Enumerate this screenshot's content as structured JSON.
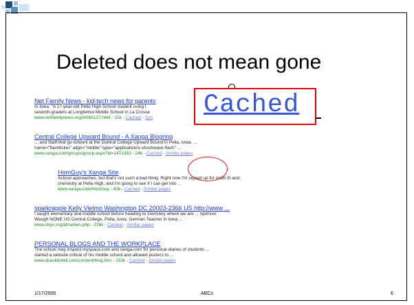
{
  "slide": {
    "title": "Deleted does not mean gone",
    "footer_date": "1/17/2008",
    "footer_center": "ABCs",
    "slide_number": "6",
    "accent_colors": {
      "corner_dark": "#1f4f7a",
      "corner_light": "#9cc3e0",
      "highlight_red": "#e30000"
    }
  },
  "callout": {
    "cached_label": "Cached"
  },
  "results": [
    {
      "title": "Net Family News - kid-tech news for parents",
      "snippet1": "In Iowa: \"A 17-year-old Pella High School student using t",
      "snippet2": "seventh-graders at Longfellow Middle School in La Crosse",
      "url": "www.netfamilynews.org/nl060127.html - 31k - ",
      "cached": "Cached",
      "sep": " - ",
      "similar": "Sim"
    },
    {
      "title": "Central College Upward Bound - A Xanga Blogring",
      "snippet1": "... and Staff that go to/work at the Central College Upward Bound in Pella, Iowa. ...",
      "snippet2": "name=\"flashticker\" align=\"middle\" type=\"application/x-shockwave-flash\" ...",
      "url": "www.xanga.com/groups/group.aspx?id=1471363 - 24k - ",
      "cached": "Cached",
      "sep": " - ",
      "similar": "Similar pages"
    },
    {
      "title": "HomGuy's Xanga Site",
      "snippet1": "School approaches, but that's not such a bad thing. Right now I'm signed up for math III and",
      "snippet2": "chemistry at Pella High, and I'm going to see if I can get into ...",
      "url": "www.xanga.com/HomGuy - 40k - ",
      "cached": "Cached",
      "sep": " - ",
      "similar": "Similar pages"
    },
    {
      "title": "sparkrapple Kelly Vielmo Washington DC 20003-2366 US http://www ...",
      "snippet1": "I taught elementary and middle school before heading to Germany where we are ... Spencer",
      "snippet2": "Waugh NONE US Central College, Pella, Iowa; German Teacher in Iowa ...",
      "url": "www.cbyx.org/allnames.php - 226k - ",
      "cached": "Cached",
      "sep": " - ",
      "similar": "Similar pages"
    },
    {
      "title": "PERSONAL BLOGS AND THE WORKPLACE",
      "snippet1": "The school may inspect myspace.com and xanga.com for personal diaries of students ...",
      "snippet2": "started a website critical of his middle school and allowed posters to ...",
      "url": "www.doaskdotell.com/content/blog.htm - 153k - ",
      "cached": "Cached",
      "sep": " - ",
      "similar": "Similar pages"
    }
  ]
}
